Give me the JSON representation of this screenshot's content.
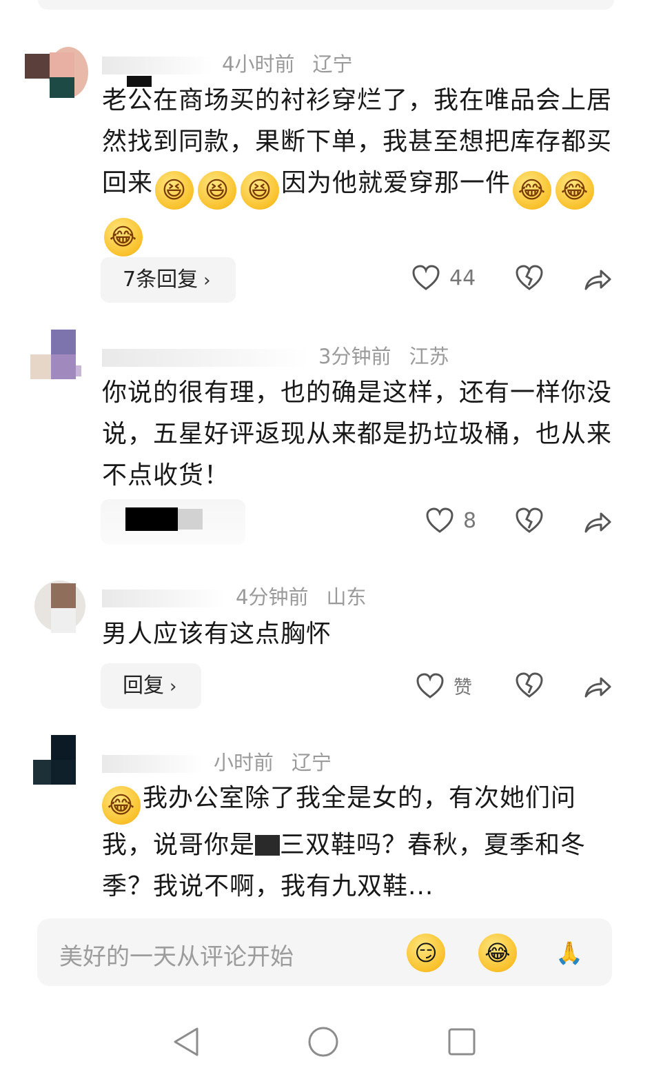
{
  "comments": [
    {
      "time": "4小时前",
      "location": "辽宁",
      "text_parts": [
        "老公在商场买的衬衫穿烂了，我在唯品会上居然找到同款，果断下单，我甚至想把库存都买回来",
        "因为他就爱穿那一件"
      ],
      "reply_label": "7条回复",
      "likes": "44"
    },
    {
      "time": "3分钟前",
      "location": "江苏",
      "text": "你说的很有理，也的确是这样，还有一样你没说，五星好评返现从来都是扔垃圾桶，也从来不点收货！",
      "likes": "8"
    },
    {
      "time": "4分钟前",
      "location": "山东",
      "text": "男人应该有这点胸怀",
      "reply_label": "回复",
      "likes": "赞"
    },
    {
      "time": "小时前",
      "location": "辽宁",
      "text_parts": [
        "我办公室除了我全是女的，有次她们问我，说哥你是",
        "三双鞋吗？春秋，夏季和冬季？我说不啊，我有九双鞋..."
      ]
    }
  ],
  "input": {
    "placeholder": "美好的一天从评论开始"
  },
  "icons": {
    "grin": "grinning-face-icon",
    "tears": "tears-of-joy-icon",
    "heart": "heart-icon",
    "broken_heart": "dislike-heart-icon",
    "share": "share-arrow-icon",
    "pray": "folded-hands-icon"
  },
  "colors": {
    "meta_gray": "#9a9a9a",
    "emoji_yellow": "#f9c12b",
    "input_bg": "#f5f5f5"
  }
}
